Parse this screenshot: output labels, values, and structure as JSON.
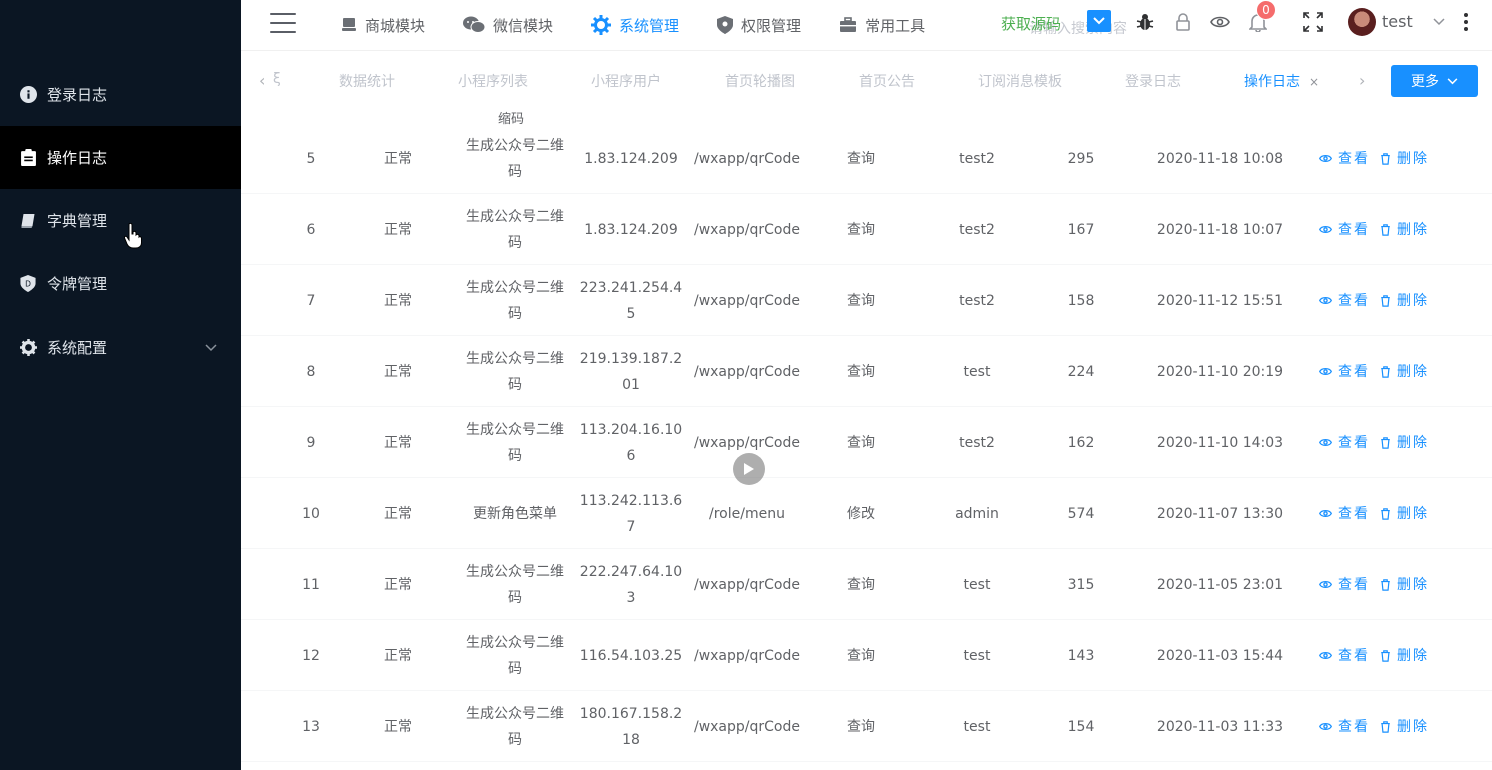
{
  "sidebar": {
    "items": [
      {
        "label": "登录日志",
        "icon": "info-icon"
      },
      {
        "label": "操作日志",
        "icon": "clipboard-icon",
        "active": true
      },
      {
        "label": "字典管理",
        "icon": "book-icon"
      },
      {
        "label": "令牌管理",
        "icon": "shield-icon"
      },
      {
        "label": "系统配置",
        "icon": "gear-icon"
      }
    ]
  },
  "topnav": {
    "items": [
      {
        "label": "商城模块",
        "icon": "store-icon"
      },
      {
        "label": "微信模块",
        "icon": "wechat-icon"
      },
      {
        "label": "系统管理",
        "icon": "gear-icon",
        "active": true
      },
      {
        "label": "权限管理",
        "icon": "shield-icon"
      },
      {
        "label": "常用工具",
        "icon": "toolbox-icon"
      }
    ],
    "get_source": "获取源码",
    "search_placeholder": "请输入搜索内容",
    "notification_count": "0",
    "username": "test"
  },
  "tabs": {
    "items": [
      "数据统计",
      "小程序列表",
      "小程序用户",
      "首页轮播图",
      "首页公告",
      "订阅消息模板",
      "登录日志",
      "操作日志"
    ],
    "active": "操作日志",
    "more_label": "更多",
    "partial_first": "ξ"
  },
  "table": {
    "partial_top": "缩码",
    "view_label": "查看",
    "delete_label": "删除",
    "rows": [
      {
        "id": "5",
        "status": "正常",
        "desc": "生成公众号二维码",
        "ip": "1.83.124.209",
        "url": "/wxapp/qrCode",
        "type": "查询",
        "user": "test2",
        "time": "295",
        "date": "2020-11-18 10:08"
      },
      {
        "id": "6",
        "status": "正常",
        "desc": "生成公众号二维码",
        "ip": "1.83.124.209",
        "url": "/wxapp/qrCode",
        "type": "查询",
        "user": "test2",
        "time": "167",
        "date": "2020-11-18 10:07"
      },
      {
        "id": "7",
        "status": "正常",
        "desc": "生成公众号二维码",
        "ip": "223.241.254.45",
        "url": "/wxapp/qrCode",
        "type": "查询",
        "user": "test2",
        "time": "158",
        "date": "2020-11-12 15:51"
      },
      {
        "id": "8",
        "status": "正常",
        "desc": "生成公众号二维码",
        "ip": "219.139.187.201",
        "url": "/wxapp/qrCode",
        "type": "查询",
        "user": "test",
        "time": "224",
        "date": "2020-11-10 20:19"
      },
      {
        "id": "9",
        "status": "正常",
        "desc": "生成公众号二维码",
        "ip": "113.204.16.106",
        "url": "/wxapp/qrCode",
        "type": "查询",
        "user": "test2",
        "time": "162",
        "date": "2020-11-10 14:03"
      },
      {
        "id": "10",
        "status": "正常",
        "desc": "更新角色菜单",
        "ip": "113.242.113.67",
        "url": "/role/menu",
        "type": "修改",
        "user": "admin",
        "time": "574",
        "date": "2020-11-07 13:30"
      },
      {
        "id": "11",
        "status": "正常",
        "desc": "生成公众号二维码",
        "ip": "222.247.64.103",
        "url": "/wxapp/qrCode",
        "type": "查询",
        "user": "test",
        "time": "315",
        "date": "2020-11-05 23:01"
      },
      {
        "id": "12",
        "status": "正常",
        "desc": "生成公众号二维码",
        "ip": "116.54.103.25",
        "url": "/wxapp/qrCode",
        "type": "查询",
        "user": "test",
        "time": "143",
        "date": "2020-11-03 15:44"
      },
      {
        "id": "13",
        "status": "正常",
        "desc": "生成公众号二维码",
        "ip": "180.167.158.218",
        "url": "/wxapp/qrCode",
        "type": "查询",
        "user": "test",
        "time": "154",
        "date": "2020-11-03 11:33"
      }
    ]
  },
  "colors": {
    "sidebar_bg": "#0b1623",
    "accent": "#1890ff",
    "source_link": "#4caf50",
    "badge": "#f56c6c"
  }
}
